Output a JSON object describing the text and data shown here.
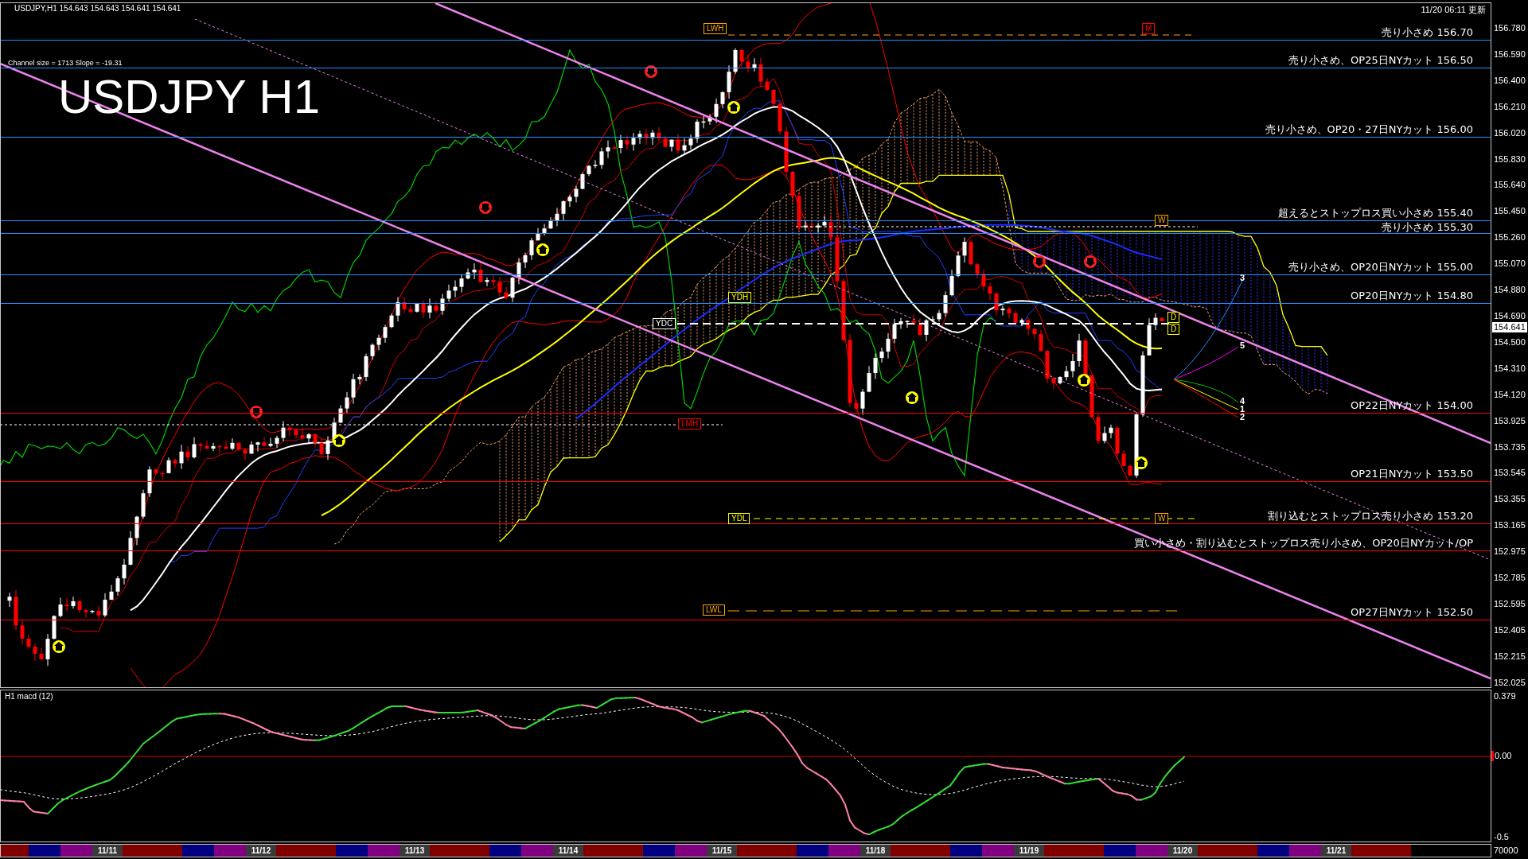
{
  "price_panel": {
    "symbol_info": "USDJPY,H1  154.643 154.643 154.641 154.641",
    "channel_info": "Channel size = 1713 Slope = -19.31",
    "title": "USDJPY H1",
    "updated": "11/20 06:11 更新",
    "levels": [
      {
        "label": "売り小さめ 156.70",
        "color": "#1e90ff"
      },
      {
        "label": "売り小さめ、OP25日NYカット 156.50",
        "color": "#1e90ff"
      },
      {
        "label": "売り小さめ、OP20・27日NYカット 156.00",
        "color": "#1e90ff"
      },
      {
        "label": "超えるとストップロス買い小さめ 155.40",
        "color": "#1e90ff"
      },
      {
        "label": "売り小さめ 155.30",
        "color": "#1e90ff"
      },
      {
        "label": "売り小さめ、OP20日NYカット 155.00",
        "color": "#1e90ff"
      },
      {
        "label": "OP20日NYカット 154.80",
        "color": "#1e90ff"
      },
      {
        "label": "OP22日NYカット 154.00",
        "color": "#ff0000"
      },
      {
        "label": "OP21日NYカット 153.50",
        "color": "#ff0000"
      },
      {
        "label": "割り込むとストップロス売り小さめ 153.20",
        "color": "#ff0000"
      },
      {
        "label": "買い小さめ・割り込むとストップロス売り小さめ、OP20日NYカット/OP",
        "color": "#ff0000"
      },
      {
        "label": "OP27日NYカット 152.50",
        "color": "#ff0000"
      }
    ],
    "markers": [
      {
        "label": "LWH",
        "color": "#ffa500"
      },
      {
        "label": "M",
        "color": "#ff0000"
      },
      {
        "label": "W",
        "color": "#ffa500"
      },
      {
        "label": "YDH",
        "color": "#ffff00"
      },
      {
        "label": "YDC",
        "color": "#ffffff"
      },
      {
        "label": "LMH",
        "color": "#ff0000"
      },
      {
        "label": "YDL",
        "color": "#ffff00"
      },
      {
        "label": "W",
        "color": "#ffa500"
      },
      {
        "label": "LWL",
        "color": "#ffa500"
      },
      {
        "label": "D",
        "color": "#ffff00"
      },
      {
        "label": "D",
        "color": "#ffff00"
      }
    ],
    "projection_labels": [
      "3",
      "5",
      "4",
      "1",
      "2"
    ],
    "y_ticks": [
      "156.780",
      "156.590",
      "156.400",
      "156.210",
      "156.020",
      "155.830",
      "155.640",
      "155.450",
      "155.260",
      "155.070",
      "154.880",
      "154.690",
      "154.500",
      "154.310",
      "154.120",
      "153.925",
      "153.735",
      "153.545",
      "153.355",
      "153.165",
      "152.975",
      "152.785",
      "152.595",
      "152.405",
      "152.215",
      "152.025"
    ],
    "current_price": "154.641"
  },
  "macd_panel": {
    "title": "H1  macd (12)",
    "y_ticks": [
      "0.379",
      "0.00",
      "-0.5"
    ]
  },
  "time_axis": {
    "dates": [
      "11/11",
      "11/12",
      "11/13",
      "11/14",
      "11/15",
      "11/18",
      "11/19",
      "11/20",
      "11/21"
    ],
    "axis_label": "70000"
  }
}
